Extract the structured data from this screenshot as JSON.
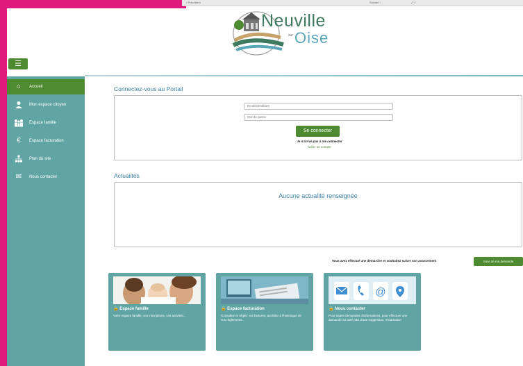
{
  "top_bar": {
    "left": "‹ Précédent",
    "middle": "Suivant ›",
    "right": "⤢ ≡"
  },
  "logo": {
    "name_line1": "Neuville",
    "name_sur": "sur",
    "name_line2": "Oise"
  },
  "menu_icon": "☰",
  "sidebar": {
    "items": [
      {
        "label": "Accueil",
        "icon": "home-icon",
        "glyph": "⌂"
      },
      {
        "label": "Mon espace citoyen",
        "icon": "user-icon",
        "glyph": "👤"
      },
      {
        "label": "Espace famille",
        "icon": "family-icon",
        "glyph": "👪"
      },
      {
        "label": "Espace facturation",
        "icon": "euro-icon",
        "glyph": "€"
      },
      {
        "label": "Plan du site",
        "icon": "sitemap-icon",
        "glyph": "⊞"
      },
      {
        "label": "Nous contacter",
        "icon": "mail-icon",
        "glyph": "✉"
      }
    ]
  },
  "login": {
    "title": "Connectez-vous au Portail",
    "email_placeholder": "Email/identifiant",
    "password_placeholder": "Mot de passe",
    "submit_label": "Se connecter",
    "forgot_label": "Je n'arrive pas à me connecter",
    "create_label": "Créer un compte"
  },
  "news": {
    "title": "Actualités",
    "empty_text": "Aucune actualité renseignée"
  },
  "follow": {
    "text": "Vous avez effectué une démarche et souhaitez suivre son avancement",
    "button_label": "Suivi de ma demande"
  },
  "cards": [
    {
      "title": "Espace famille",
      "desc": "Votre espace famille, vos inscriptions, vos activités..."
    },
    {
      "title": "Espace facturation",
      "desc": "Consultez et réglez vos factures, accédez à l'historique de vos règlements"
    },
    {
      "title": "Nous contacter",
      "desc": "Pour toutes demandes d'informations, pour effectuer une demande ou faire part d'une suggestion, réclamation"
    }
  ],
  "colors": {
    "accent_green": "#4e8a2f",
    "teal": "#61a4a4",
    "title_blue": "#3b7fa0",
    "magenta": "#e0197d"
  }
}
